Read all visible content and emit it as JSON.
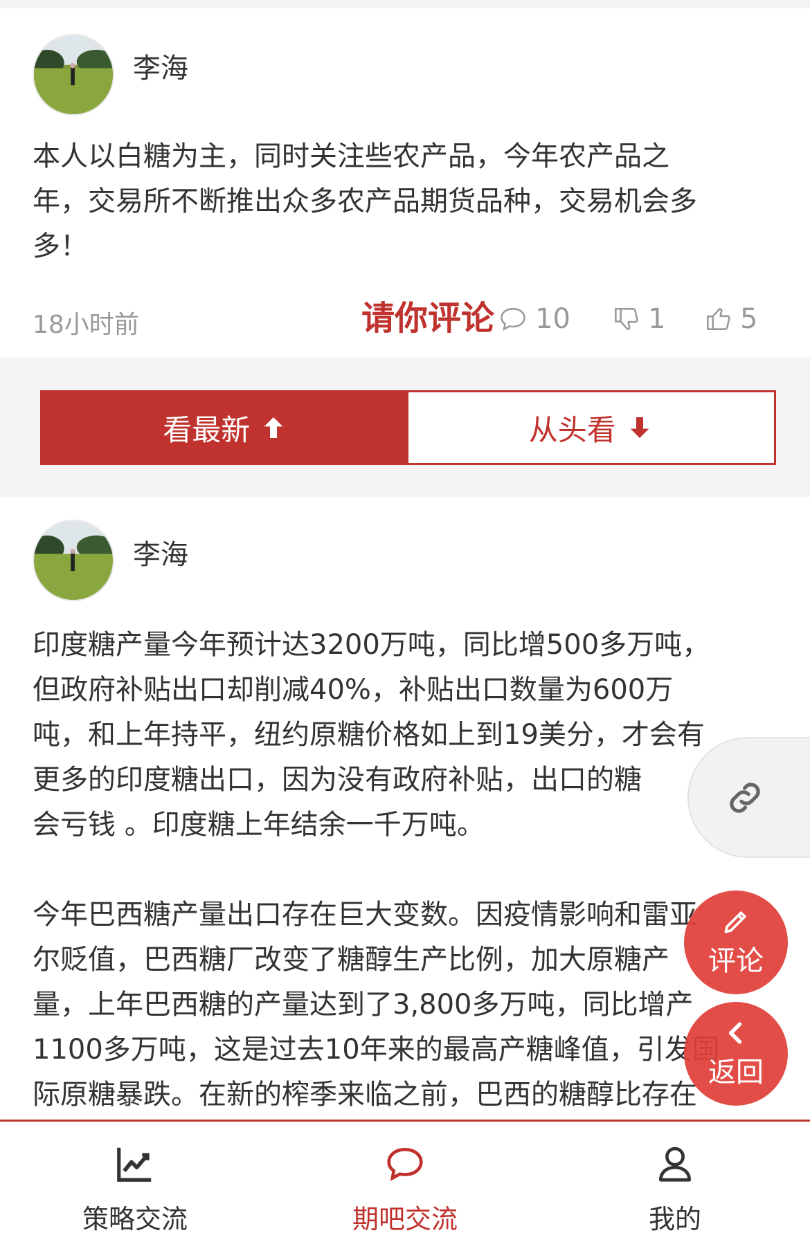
{
  "posts": [
    {
      "author": "李海",
      "content": "本人以白糖为主，同时关注些农产品，今年农产品之\n年，交易所不断推出众多农产品期货品种，交易机会多\n多！",
      "time": "18小时前",
      "invite_label": "请你评论",
      "comments": "10",
      "dislikes": "1",
      "likes": "5"
    },
    {
      "author": "李海",
      "content": "印度糖产量今年预计达3200万吨，同比增500多万吨，\n但政府补贴出口却削减40%，补贴出口数量为600万\n吨，和上年持平，纽约原糖价格如上到19美分，才会有\n更多的印度糖出口，因为没有政府补贴，出口的糖\n会亏钱 。印度糖上年结余一千万吨。\n\n今年巴西糖产量出口存在巨大变数。因疫情影响和雷亚\n尔贬值，巴西糖厂改变了糖醇生产比例，加大原糖产\n量，上年巴西糖的产量达到了3,800多万吨，同比增产\n1100多万吨，这是过去10年来的最高产糖峰值，引发国\n际原糖暴跌。在新的榨季来临之前，巴西的糖醇比存在"
    }
  ],
  "sort": {
    "newest_label": "看最新",
    "oldest_label": "从头看"
  },
  "floating": {
    "comment_label": "评论",
    "back_label": "返回"
  },
  "tabs": [
    {
      "label": "策略交流",
      "icon": "chart-line-icon",
      "active": false
    },
    {
      "label": "期吧交流",
      "icon": "chat-bubble-icon",
      "active": true
    },
    {
      "label": "我的",
      "icon": "user-icon",
      "active": false
    }
  ],
  "colors": {
    "accent": "#c0322d",
    "fab": "#e0403a",
    "muted": "#999999"
  }
}
